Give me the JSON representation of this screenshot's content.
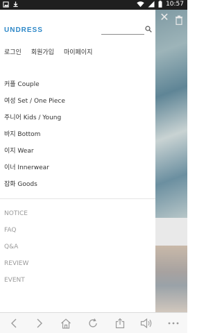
{
  "status_bar": {
    "time": "10:57",
    "icons": [
      "photo-icon",
      "download-icon",
      "wifi-icon",
      "signal-icon",
      "battery-icon"
    ]
  },
  "drawer": {
    "logo": "UNDRESS",
    "search": {
      "value": "",
      "placeholder": ""
    },
    "account_links": [
      "로그인",
      "회원가입",
      "마이페이지"
    ],
    "categories": [
      "커플 Couple",
      "여성 Set / One Piece",
      "주니어 Kids / Young",
      "바지 Bottom",
      "이지 Wear",
      "이너 Innerwear",
      "잡화 Goods"
    ],
    "info_links": [
      "NOTICE",
      "FAQ",
      "Q&A",
      "REVIEW",
      "EVENT"
    ]
  },
  "overlay": {
    "close_icon": "close-icon",
    "trash_icon": "trash-icon"
  },
  "toolbar": {
    "buttons": [
      "back-icon",
      "forward-icon",
      "home-icon",
      "refresh-icon",
      "share-icon",
      "volume-icon",
      "more-icon"
    ]
  },
  "colors": {
    "logo": "#2e88c8",
    "status_bar": "#1f1f1f",
    "info_text": "#9a9a9a",
    "menu_text": "#333333"
  }
}
